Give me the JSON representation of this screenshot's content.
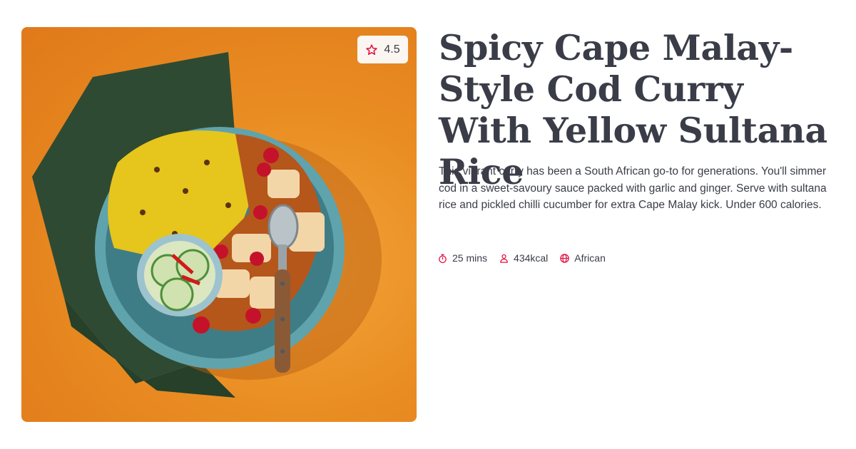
{
  "recipe": {
    "rating": "4.5",
    "title": "Spicy Cape Malay-Style Cod Curry With Yellow Sultana Rice",
    "description": "This vibrant curry has been a South African go-to for generations. You'll simmer cod in a sweet-savoury sauce packed with garlic and ginger. Serve with sultana rice and pickled chilli cucumber for extra Cape Malay kick. Under 600 calories.",
    "meta": {
      "time": "25 mins",
      "calories": "434kcal",
      "cuisine": "African"
    },
    "icons": {
      "rating": "star-outline-icon",
      "time": "timer-icon",
      "calories": "person-icon",
      "cuisine": "globe-icon"
    }
  },
  "colors": {
    "accent": "#e0103f",
    "text": "#3a3d48",
    "photo_background": "#e98d22"
  }
}
